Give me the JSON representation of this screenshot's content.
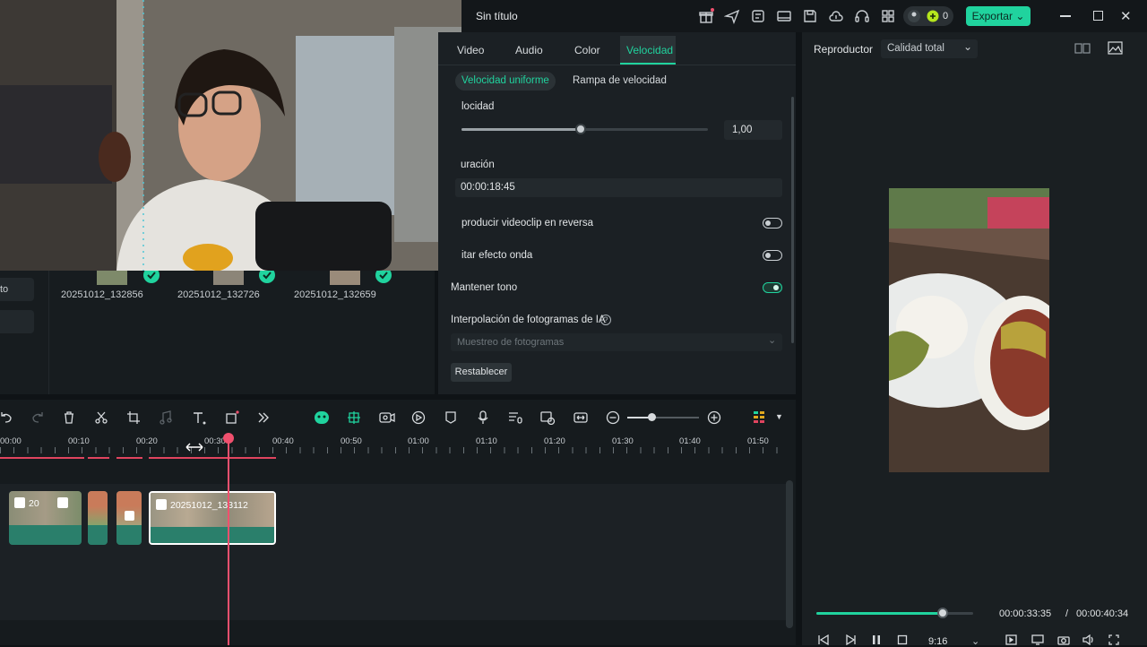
{
  "app": {
    "title": "Sin título",
    "export_label": "Exportar",
    "credits_count": "0",
    "accent": "#20d39e"
  },
  "media": {
    "items": [
      {
        "name": "20251012_132856"
      },
      {
        "name": "20251012_132726"
      },
      {
        "name": "20251012_132659"
      }
    ],
    "side_label": "to"
  },
  "properties": {
    "tabs": [
      {
        "label": "Video"
      },
      {
        "label": "Audio"
      },
      {
        "label": "Color"
      },
      {
        "label": "Velocidad",
        "active": true
      }
    ],
    "subtabs": [
      {
        "label": "Velocidad uniforme",
        "active": true
      },
      {
        "label": "Rampa de velocidad"
      }
    ],
    "speed_label": "locidad",
    "speed_value": "1,00",
    "speed_level": 0.48,
    "duration_label": "uración",
    "duration_value": "00:00:18:45",
    "reverse_label": "producir videoclip en reversa",
    "reverse_on": false,
    "ripple_label": "itar efecto onda",
    "ripple_on": false,
    "keep_pitch_label": "Mantener tono",
    "keep_pitch_on": true,
    "interp_label": "Interpolación de fotogramas de IA",
    "interp_placeholder": "Muestreo de fotogramas",
    "reset_label": "Restablecer"
  },
  "player": {
    "title": "Reproductor",
    "quality": "Calidad total",
    "time_current": "00:00:33:35",
    "time_sep": "/",
    "time_total": "00:00:40:34",
    "progress": 0.81,
    "ratio": "9:16"
  },
  "timeline": {
    "ruler": [
      "00:00",
      "00:10",
      "00:20",
      "00:30",
      "00:40",
      "00:50",
      "01:00",
      "01:10",
      "01:20",
      "01:30",
      "01:40",
      "01:50"
    ],
    "clips": [
      {
        "title": "20",
        "selected": false
      },
      {
        "title": "",
        "selected": false
      },
      {
        "title": "",
        "selected": false
      },
      {
        "title": "20251012_133112",
        "selected": true
      }
    ],
    "zoom_level": 0.34
  }
}
